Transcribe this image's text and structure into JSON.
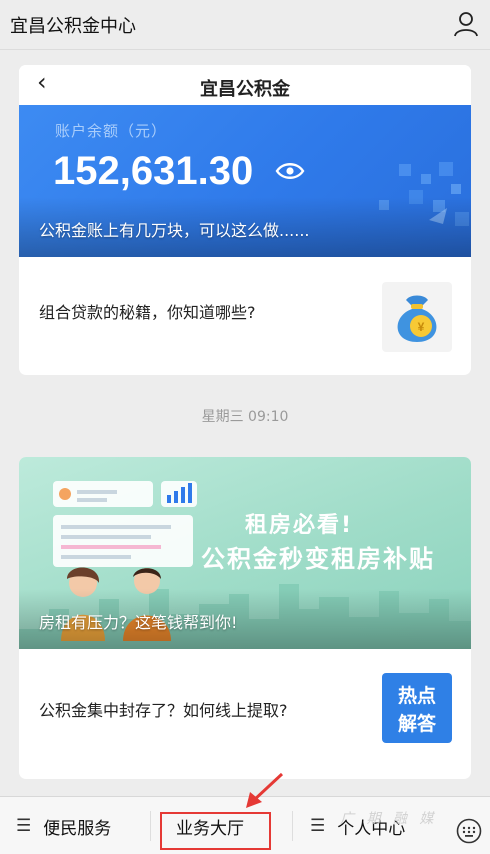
{
  "header": {
    "title": "宜昌公积金中心",
    "user_icon": "user-icon"
  },
  "feed": {
    "card1": {
      "hero": {
        "app_title": "宜昌公积金",
        "back_icon": "back-chevron-icon",
        "balance_label": "账户余额（元）",
        "balance_value": "152,631.30",
        "eye_icon": "eye-icon",
        "caption": "公积金账上有几万块，可以这么做......"
      },
      "item": {
        "text": "组合贷款的秘籍，你知道哪些?",
        "thumb": "money-bag-icon"
      }
    },
    "timestamp": "星期三 09:10",
    "card2": {
      "hero": {
        "headline1": "租房必看!",
        "headline2": "公积金秒变租房补贴",
        "caption": "房租有压力？这笔钱帮到你!"
      },
      "item": {
        "text": "公积金集中封存了？如何线上提取?",
        "thumb_line1": "热点",
        "thumb_line2": "解答"
      }
    }
  },
  "menu": {
    "items": [
      {
        "label": "便民服务",
        "icon": "menu-lines-icon"
      },
      {
        "label": "业务大厅",
        "icon": ""
      },
      {
        "label": "个人中心",
        "icon": "menu-lines-icon"
      }
    ],
    "keyboard_icon": "keyboard-icon",
    "highlight_color": "#e53935"
  },
  "colors": {
    "accent_blue": "#2f7aea",
    "teal_banner": "#9fdcc8",
    "background": "#ededed"
  }
}
